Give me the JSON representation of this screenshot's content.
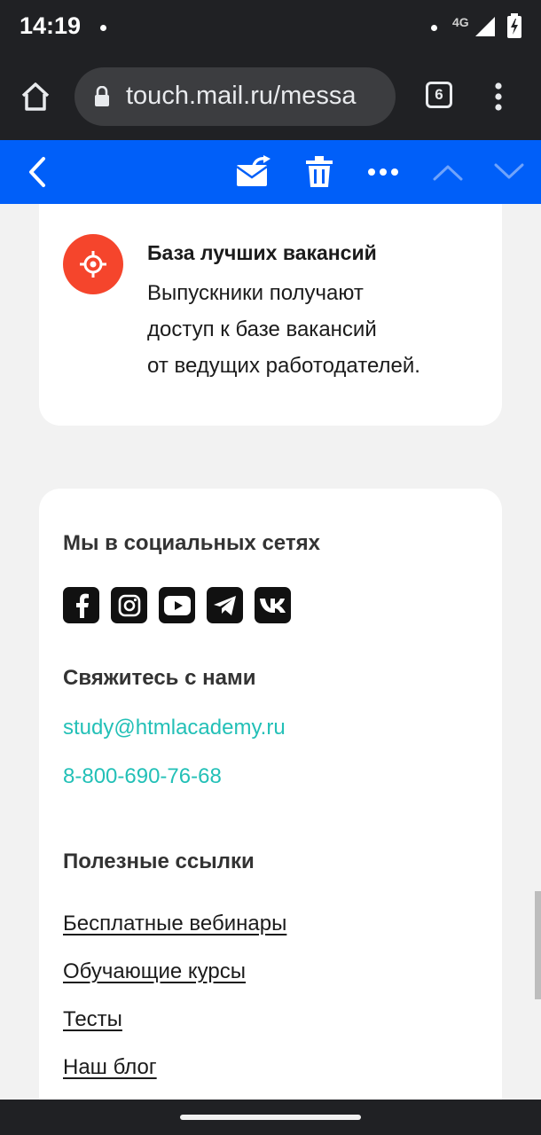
{
  "status_bar": {
    "time": "14:19",
    "network": "4G",
    "icons": [
      "notification-dot-icon",
      "signal-icon",
      "battery-charging-icon"
    ]
  },
  "browser": {
    "url": "touch.mail.ru/messa",
    "tab_count": "6",
    "icons": [
      "home-icon",
      "lock-icon",
      "more-vert-icon"
    ]
  },
  "mail_toolbar": {
    "color": "#005ff9",
    "icons": [
      "back-chevron-icon",
      "move-to-folder-icon",
      "trash-icon",
      "more-dots-icon",
      "prev-message-icon",
      "next-message-icon"
    ]
  },
  "feature": {
    "icon": "target-icon",
    "accent": "#f5452c",
    "title": "База лучших вакансий",
    "desc_line1": "Выпускники получают",
    "desc_line2": "доступ к базе вакансий",
    "desc_line3": "от ведущих работодателей."
  },
  "social": {
    "heading": "Мы в социальных сетях",
    "items": [
      "facebook-icon",
      "instagram-icon",
      "youtube-icon",
      "telegram-icon",
      "vk-icon"
    ]
  },
  "contact": {
    "heading": "Свяжитесь с нами",
    "email": "study@htmlacademy.ru",
    "phone": "8-800-690-76-68",
    "color": "#23c0b7"
  },
  "links": {
    "heading": "Полезные ссылки",
    "items": [
      "Бесплатные вебинары",
      "Обучающие курсы",
      "Тесты",
      "Наш блог"
    ]
  }
}
